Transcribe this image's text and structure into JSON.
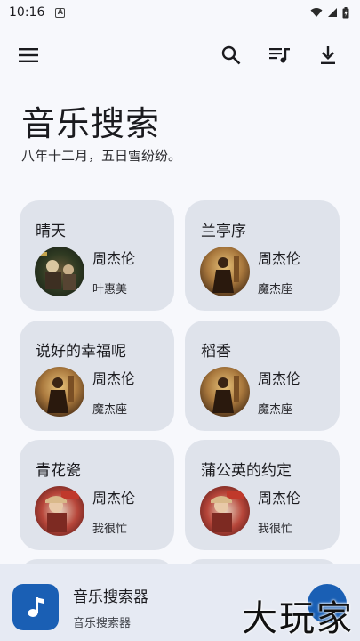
{
  "status_bar": {
    "time": "10:16",
    "notification_glyph": "A"
  },
  "app": {
    "title": "音乐搜索",
    "subtitle": "八年十二月，五日雪纷纷。"
  },
  "toolbar": {
    "menu_icon": "menu-icon",
    "search_icon": "search-icon",
    "playlist_icon": "playlist-icon",
    "download_icon": "download-icon"
  },
  "songs": [
    {
      "title": "晴天",
      "singer": "周杰伦",
      "album": "叶惠美",
      "art": "art-green"
    },
    {
      "title": "兰亭序",
      "singer": "周杰伦",
      "album": "魔杰座",
      "art": "art-brown"
    },
    {
      "title": "说好的幸福呢",
      "singer": "周杰伦",
      "album": "魔杰座",
      "art": "art-brown"
    },
    {
      "title": "稻香",
      "singer": "周杰伦",
      "album": "魔杰座",
      "art": "art-brown"
    },
    {
      "title": "青花瓷",
      "singer": "周杰伦",
      "album": "我很忙",
      "art": "art-red"
    },
    {
      "title": "蒲公英的约定",
      "singer": "周杰伦",
      "album": "我很忙",
      "art": "art-red"
    }
  ],
  "player": {
    "title": "音乐搜索器",
    "subtitle": "音乐搜索器",
    "icon": "music-note-icon"
  },
  "watermark": "大玩家",
  "colors": {
    "background": "#f7f8fc",
    "card": "#dfe3eb",
    "accent": "#1a5fb4",
    "player_bar": "#e6eaf3"
  }
}
